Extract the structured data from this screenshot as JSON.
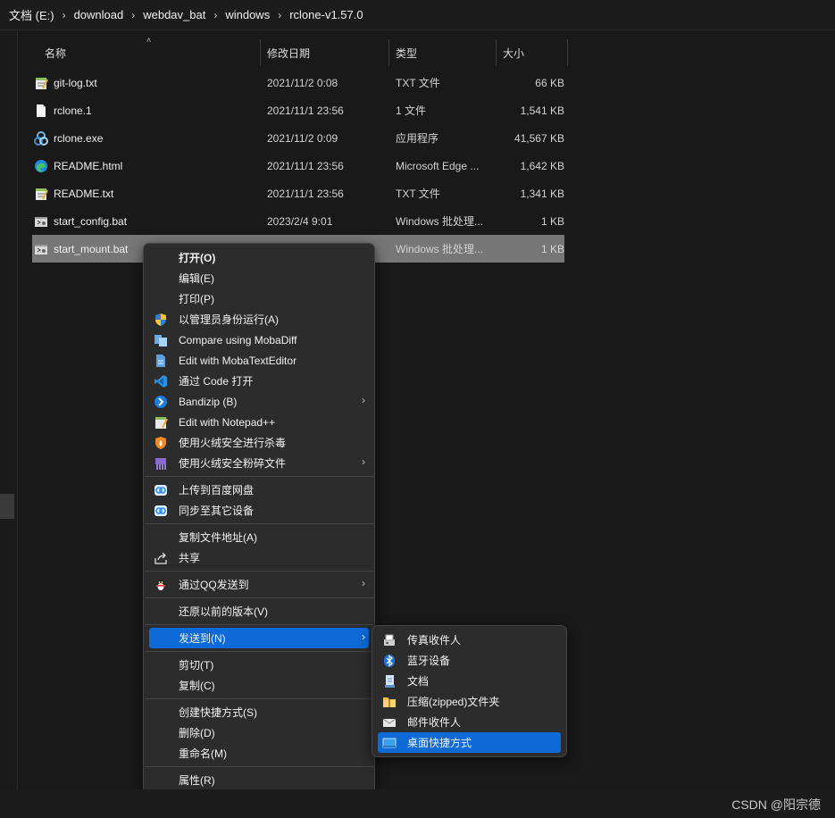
{
  "breadcrumb": [
    "文档 (E:)",
    "download",
    "webdav_bat",
    "windows",
    "rclone-v1.57.0"
  ],
  "columns": {
    "name": "名称",
    "date": "修改日期",
    "type": "类型",
    "size": "大小"
  },
  "files": [
    {
      "name": "git-log.txt",
      "date": "2021/11/2 0:08",
      "type": "TXT 文件",
      "size": "66 KB",
      "icon": "notepad-icon"
    },
    {
      "name": "rclone.1",
      "date": "2021/11/1 23:56",
      "type": "1 文件",
      "size": "1,541 KB",
      "icon": "blank-file-icon"
    },
    {
      "name": "rclone.exe",
      "date": "2021/11/2 0:09",
      "type": "应用程序",
      "size": "41,567 KB",
      "icon": "rclone-icon"
    },
    {
      "name": "README.html",
      "date": "2021/11/1 23:56",
      "type": "Microsoft Edge ...",
      "size": "1,642 KB",
      "icon": "edge-icon"
    },
    {
      "name": "README.txt",
      "date": "2021/11/1 23:56",
      "type": "TXT 文件",
      "size": "1,341 KB",
      "icon": "notepad-icon"
    },
    {
      "name": "start_config.bat",
      "date": "2023/2/4 9:01",
      "type": "Windows 批处理...",
      "size": "1 KB",
      "icon": "batch-file-icon"
    },
    {
      "name": "start_mount.bat",
      "date": "",
      "type": "Windows 批处理...",
      "size": "1 KB",
      "icon": "batch-file-icon"
    }
  ],
  "menu": {
    "open": "打开(O)",
    "edit": "编辑(E)",
    "print": "打印(P)",
    "run_as_admin": "以管理员身份运行(A)",
    "mobadiff": "Compare using MobaDiff",
    "mobatext": "Edit with MobaTextEditor",
    "vscode": "通过 Code 打开",
    "bandizip": "Bandizip (B)",
    "notepadpp": "Edit with Notepad++",
    "huorong_scan": "使用火绒安全进行杀毒",
    "huorong_shred": "使用火绒安全粉碎文件",
    "baidu_upload": "上传到百度网盘",
    "baidu_sync": "同步至其它设备",
    "copy_path": "复制文件地址(A)",
    "share": "共享",
    "qq_send": "通过QQ发送到",
    "restore": "还原以前的版本(V)",
    "send_to": "发送到(N)",
    "cut": "剪切(T)",
    "copy": "复制(C)",
    "create_shortcut": "创建快捷方式(S)",
    "delete": "删除(D)",
    "rename": "重命名(M)",
    "properties": "属性(R)"
  },
  "submenu": {
    "fax": "传真收件人",
    "bluetooth": "蓝牙设备",
    "documents": "文档",
    "zip": "压缩(zipped)文件夹",
    "mail": "邮件收件人",
    "desktop": "桌面快捷方式"
  },
  "watermark": "CSDN @阳宗德",
  "colors": {
    "highlight": "#0e6ad6",
    "selected_row": "#777777",
    "background": "#191919"
  }
}
